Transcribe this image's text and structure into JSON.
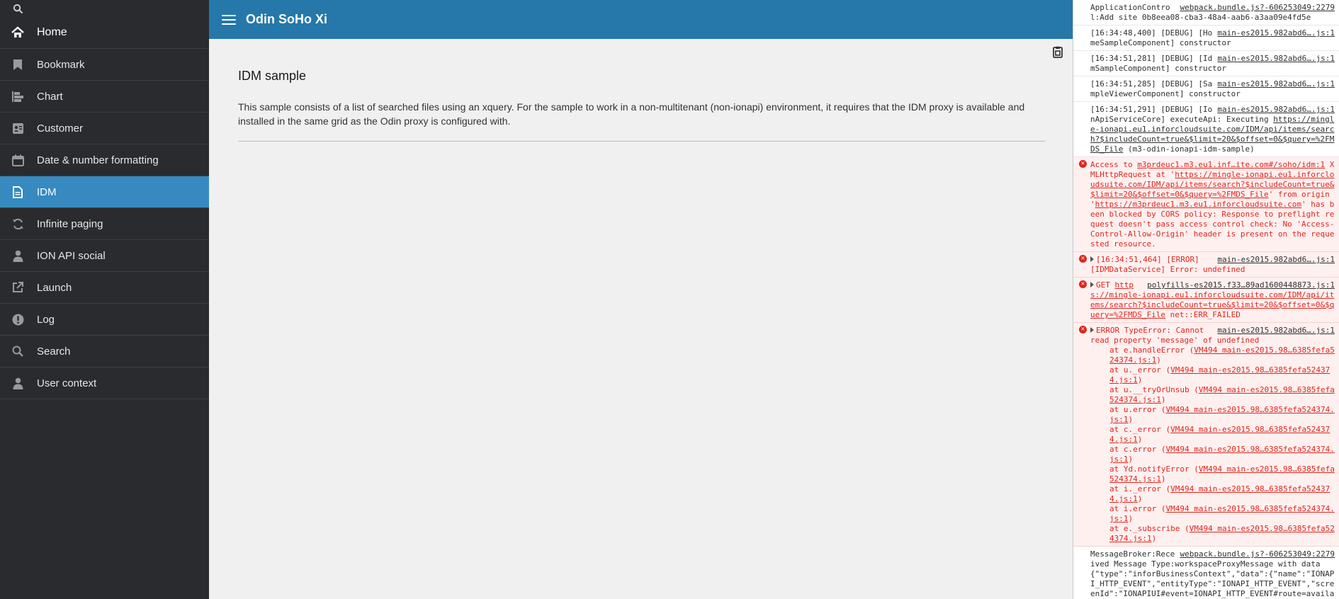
{
  "sidebar": {
    "items": [
      {
        "label": "Home",
        "icon": "home-icon"
      },
      {
        "label": "Bookmark",
        "icon": "bookmark-icon"
      },
      {
        "label": "Chart",
        "icon": "chart-icon"
      },
      {
        "label": "Customer",
        "icon": "customer-card-icon"
      },
      {
        "label": "Date & number formatting",
        "icon": "calendar-icon"
      },
      {
        "label": "IDM",
        "icon": "document-icon"
      },
      {
        "label": "Infinite paging",
        "icon": "refresh-icon"
      },
      {
        "label": "ION API social",
        "icon": "person-icon"
      },
      {
        "label": "Launch",
        "icon": "launch-icon"
      },
      {
        "label": "Log",
        "icon": "alert-icon"
      },
      {
        "label": "Search",
        "icon": "search-icon"
      },
      {
        "label": "User context",
        "icon": "person-icon"
      }
    ],
    "active_index": 5
  },
  "header": {
    "title": "Odin SoHo Xi"
  },
  "main": {
    "title": "IDM sample",
    "description": "This sample consists of a list of searched files using an xquery. For the sample to work in a non-multitenant (non-ionapi) environment, it requires that the IDM proxy is available and installed in the same grid as the Odin proxy is configured with."
  },
  "colors": {
    "sidebar": "#2a2b2e",
    "header": "#2578a9",
    "active": "#368ac0",
    "error": "#e0251b"
  },
  "console": {
    "log1": {
      "text": "ApplicationControl:Add site 0b8eea08-cba3-48a4-aab6-a3aa09e4fd5e",
      "src": "webpack.bundle.js?-606253049:2279"
    },
    "log2": {
      "text": "[16:34:48,400] [DEBUG] [HomeSampleComponent] constructor",
      "src": "main-es2015.982abd6….js:1"
    },
    "log3": {
      "text": "[16:34:51,281] [DEBUG] [IdmSampleComponent] constructor",
      "src": "main-es2015.982abd6….js:1"
    },
    "log4": {
      "text": "[16:34:51,285] [DEBUG] [SampleViewerComponent] constructor",
      "src": "main-es2015.982abd6….js:1"
    },
    "log5": {
      "text_a": "[16:34:51,291] [DEBUG] [IonApiServiceCore] executeApi: Executing ",
      "url": "https://mingle-ionapi.eu1.inforcloudsuite.com/IDM/api/items/search?$includeCount=true&$limit=20&$offset=0&$query=%2FMDS_File",
      "text_b": " (m3-odin-ionapi-idm-sample)",
      "src": "main-es2015.982abd6….js:1"
    },
    "err1": {
      "text_a": "Access to ",
      "src_a": "m3prdeuc1.m3.eu1.inf…ite.com#/soho/idm:1",
      "text_b": " XMLHttpRequest at '",
      "url1": "https://mingle-ionapi.eu1.inforcloudsuite.com/IDM/api/items/search?$includeCount=true&$limit=20&$offset=0&$query=%2FMDS_File",
      "text_c": "' from origin '",
      "url2": "https://m3prdeuc1.m3.eu1.inforcloudsuite.com",
      "text_d": "' has been blocked by CORS policy: Response to preflight request doesn't pass access control check: No 'Access-Control-Allow-Origin' header is present on the requested resource."
    },
    "err2": {
      "text": "[16:34:51,464] [ERROR] [IDMDataService] Error: undefined",
      "src": "main-es2015.982abd6….js:1"
    },
    "err3": {
      "text_a": "GET ",
      "url": "https://mingle-ionapi.eu1.inforcloudsuite.com/IDM/api/items/search?$includeCount=true&$limit=20&$offset=0&$query=%2FMDS_File",
      "text_b": " net::ERR_FAILED",
      "src": "polyfills-es2015.f33…89ad1600448873.js:1"
    },
    "err4": {
      "text": "ERROR TypeError: Cannot read property 'message' of undefined",
      "src": "main-es2015.982abd6….js:1",
      "stack": [
        {
          "fn": "at e.handleError",
          "loc": "VM494 main-es2015.98…6385fefa524374.js:1"
        },
        {
          "fn": "at u._error",
          "loc": "VM494 main-es2015.98…6385fefa524374.js:1"
        },
        {
          "fn": "at u.__tryOrUnsub",
          "loc": "VM494 main-es2015.98…6385fefa524374.js:1"
        },
        {
          "fn": "at u.error",
          "loc": "VM494 main-es2015.98…6385fefa524374.js:1"
        },
        {
          "fn": "at c._error",
          "loc": "VM494 main-es2015.98…6385fefa524374.js:1"
        },
        {
          "fn": "at c.error",
          "loc": "VM494 main-es2015.98…6385fefa524374.js:1"
        },
        {
          "fn": "at Yd.notifyError",
          "loc": "VM494 main-es2015.98…6385fefa524374.js:1"
        },
        {
          "fn": "at i._error",
          "loc": "VM494 main-es2015.98…6385fefa524374.js:1"
        },
        {
          "fn": "at i.error",
          "loc": "VM494 main-es2015.98…6385fefa524374.js:1"
        },
        {
          "fn": "at e._subscribe",
          "loc": "VM494 main-es2015.98…6385fefa524374.js:1"
        }
      ]
    },
    "log6": {
      "text": "MessageBroker:Received Message Type:workspaceProxyMessage with data {\"type\":\"inforBusinessContext\",\"data\":{\"name\":\"IONAPI_HTTP_EVENT\",\"entityType\":\"IONAPI_HTTP_EVENT\",\"screenId\":\"IONAPIUI#event=IONAPI_HTTP_EVENT#route=available-",
      "src": "webpack.bundle.js?-606253049:2279"
    }
  }
}
